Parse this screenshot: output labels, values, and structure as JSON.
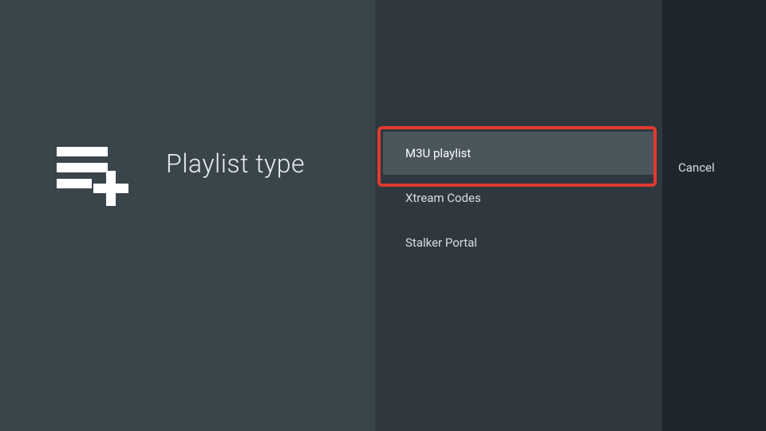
{
  "header": {
    "title": "Playlist type",
    "icon_name": "playlist-add"
  },
  "options": [
    {
      "label": "M3U playlist",
      "selected": true
    },
    {
      "label": "Xtream Codes",
      "selected": false
    },
    {
      "label": "Stalker Portal",
      "selected": false
    }
  ],
  "actions": {
    "cancel_label": "Cancel"
  },
  "annotation": {
    "highlighted_index": 0
  }
}
